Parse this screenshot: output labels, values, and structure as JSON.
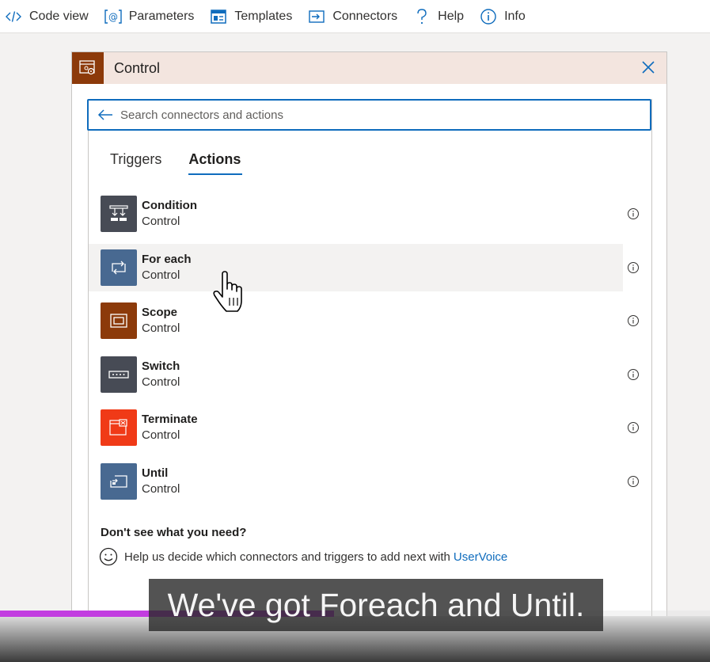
{
  "toolbar": {
    "items": [
      {
        "label": "Code view",
        "icon": "code-icon"
      },
      {
        "label": "Parameters",
        "icon": "parameters-icon"
      },
      {
        "label": "Templates",
        "icon": "templates-icon"
      },
      {
        "label": "Connectors",
        "icon": "connectors-icon"
      },
      {
        "label": "Help",
        "icon": "help-icon"
      },
      {
        "label": "Info",
        "icon": "info-icon"
      }
    ]
  },
  "card": {
    "title": "Control",
    "header_color": "#8c3a0a"
  },
  "search": {
    "placeholder": "Search connectors and actions",
    "value": ""
  },
  "tabs": [
    {
      "label": "Triggers",
      "active": false
    },
    {
      "label": "Actions",
      "active": true
    }
  ],
  "actions": [
    {
      "name": "Condition",
      "connector": "Control",
      "icon": "condition-icon",
      "color": "#474b55"
    },
    {
      "name": "For each",
      "connector": "Control",
      "icon": "foreach-icon",
      "color": "#486991"
    },
    {
      "name": "Scope",
      "connector": "Control",
      "icon": "scope-icon",
      "color": "#8c3a0a"
    },
    {
      "name": "Switch",
      "connector": "Control",
      "icon": "switch-icon",
      "color": "#474b55"
    },
    {
      "name": "Terminate",
      "connector": "Control",
      "icon": "terminate-icon",
      "color": "#f03a17"
    },
    {
      "name": "Until",
      "connector": "Control",
      "icon": "until-icon",
      "color": "#486991"
    }
  ],
  "footer": {
    "heading": "Don't see what you need?",
    "help_text": "Help us decide which connectors and triggers to add next with",
    "link": "UserVoice"
  },
  "video": {
    "caption": "We've got Foreach and Until.",
    "progress": 0.47,
    "progress_color": "#c23de0"
  }
}
